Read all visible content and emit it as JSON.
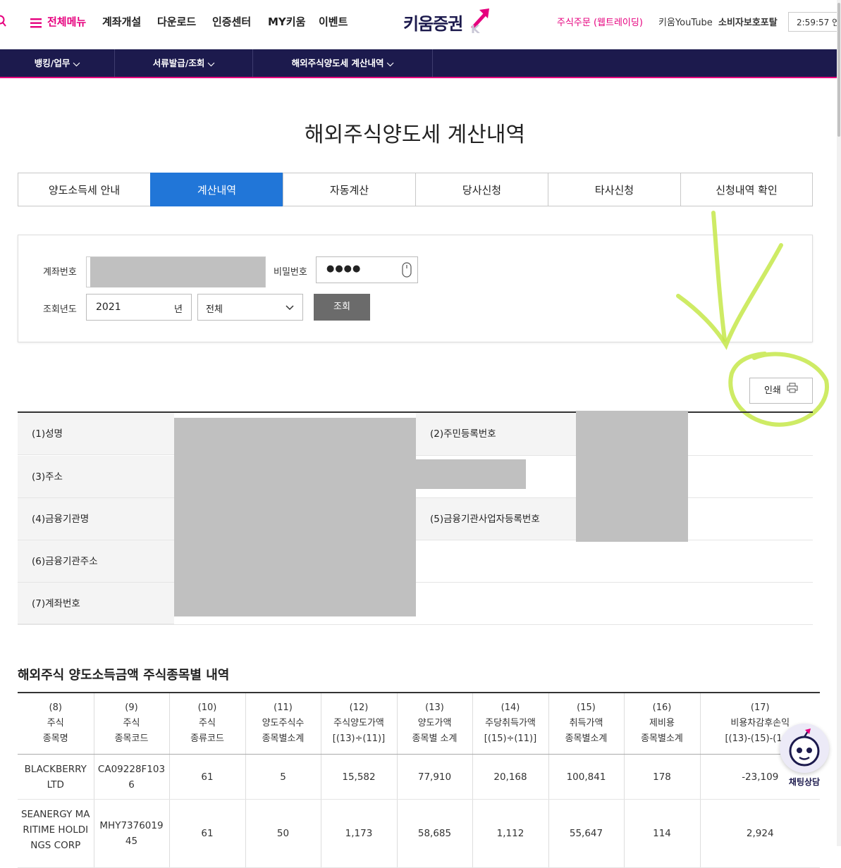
{
  "header": {
    "search_icon": "search-icon",
    "menu_icon": "hamburger-icon",
    "menu_label": "전체메뉴",
    "links": [
      "계좌개설",
      "다운로드",
      "인증센터",
      "MY키움",
      "이벤트"
    ],
    "logo_text": "키움증권",
    "right_links": [
      "주식주문 (웹트레이딩)",
      "키움YouTube",
      "소비자보호포탈"
    ],
    "clock": "2:59:57 연",
    "colors": {
      "brand_pink": "#e6007e",
      "nav_bg": "#1c1a4d",
      "tab_active": "#2176d8"
    }
  },
  "nav": {
    "items": [
      "뱅킹/업무",
      "서류발급/조회",
      "해외주식양도세 계산내역"
    ]
  },
  "page": {
    "title": "해외주식양도세 계산내역"
  },
  "tabs": {
    "items": [
      "양도소득세 안내",
      "계산내역",
      "자동계산",
      "당사신청",
      "타사신청",
      "신청내역 확인"
    ],
    "active_index": 1
  },
  "search": {
    "account_label": "계좌번호",
    "password_label": "비밀번호",
    "password_value": "●●●●",
    "year_label": "조회년도",
    "year_value": "2021",
    "year_suffix": "년",
    "select_value": "전체",
    "query_button": "조회"
  },
  "print_button": "인쇄",
  "info": {
    "labels": [
      "(1)성명",
      "(2)주민등록번호",
      "(3)주소",
      "(4)금융기관명",
      "(5)금융기관사업자등록번호",
      "(6)금융기관주소",
      "(7)계좌번호"
    ]
  },
  "stock_section": {
    "title": "해외주식 양도소득금액 주식종목별 내역",
    "headers": [
      [
        "(8)",
        "주식",
        "종목명"
      ],
      [
        "(9)",
        "주식",
        "종목코드"
      ],
      [
        "(10)",
        "주식",
        "종류코드"
      ],
      [
        "(11)",
        "양도주식수",
        "종목별소계"
      ],
      [
        "(12)",
        "주식양도가액",
        "[(13)÷(11)]"
      ],
      [
        "(13)",
        "양도가액",
        "종목별 소계"
      ],
      [
        "(14)",
        "주당취득가액",
        "[(15)÷(11)]"
      ],
      [
        "(15)",
        "취득가액",
        "종목별소계"
      ],
      [
        "(16)",
        "제비용",
        "종목별소계"
      ],
      [
        "(17)",
        "비용차감후손익",
        "[(13)-(15)-(16)]"
      ]
    ],
    "rows": [
      [
        "BLACKBERRY LTD",
        "CA09228F1036",
        "61",
        "5",
        "15,582",
        "77,910",
        "20,168",
        "100,841",
        "178",
        "-23,109"
      ],
      [
        "SEANERGY MARITIME HOLDINGS CORP",
        "MHY737601945",
        "61",
        "50",
        "1,173",
        "58,685",
        "1,112",
        "55,647",
        "114",
        "2,924"
      ]
    ]
  },
  "chat": {
    "label": "채팅상담",
    "icon": "chatbot-icon"
  },
  "annotation": {
    "color": "#c5e84a"
  }
}
